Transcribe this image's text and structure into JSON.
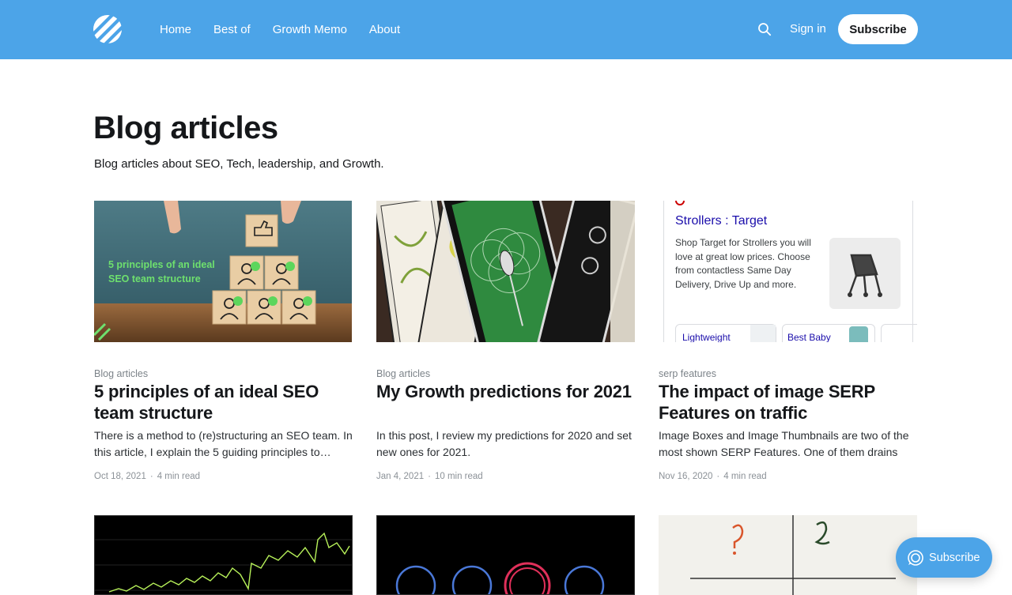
{
  "header": {
    "nav": [
      "Home",
      "Best of",
      "Growth Memo",
      "About"
    ],
    "signin": "Sign in",
    "subscribe": "Subscribe"
  },
  "page": {
    "title": "Blog articles",
    "description": "Blog articles about SEO, Tech, leadership, and Growth."
  },
  "cards": [
    {
      "tag": "Blog articles",
      "title": "5 principles of an ideal SEO team structure",
      "excerpt": "There is a method to (re)structuring an SEO team. In this article, I explain the 5 guiding principles to…",
      "date": "Oct 18, 2021",
      "read": "4 min read",
      "image_text": "5 principles of an ideal SEO team structure"
    },
    {
      "tag": "Blog articles",
      "title": "My Growth predictions for 2021",
      "excerpt": "In this post, I review my predictions for 2020 and set new ones for 2021.",
      "date": "Jan 4, 2021",
      "read": "10 min read"
    },
    {
      "tag": "serp features",
      "title": "The impact of image SERP Features on traffic",
      "excerpt": "Image Boxes and Image Thumbnails are two of the most shown SERP Features. One of them drains a…",
      "date": "Nov 16, 2020",
      "read": "4 min read",
      "image": {
        "heading": "Strollers : Target",
        "body": "Shop Target for Strollers you will love at great low prices. Choose from contactless Same Day Delivery, Drive Up and more.",
        "chips": [
          "Lightweight",
          "Best Baby"
        ]
      }
    }
  ],
  "float_subscribe": "Subscribe",
  "colors": {
    "brand": "#4ca4e8",
    "text": "#15171a",
    "muted": "#7c8389"
  }
}
